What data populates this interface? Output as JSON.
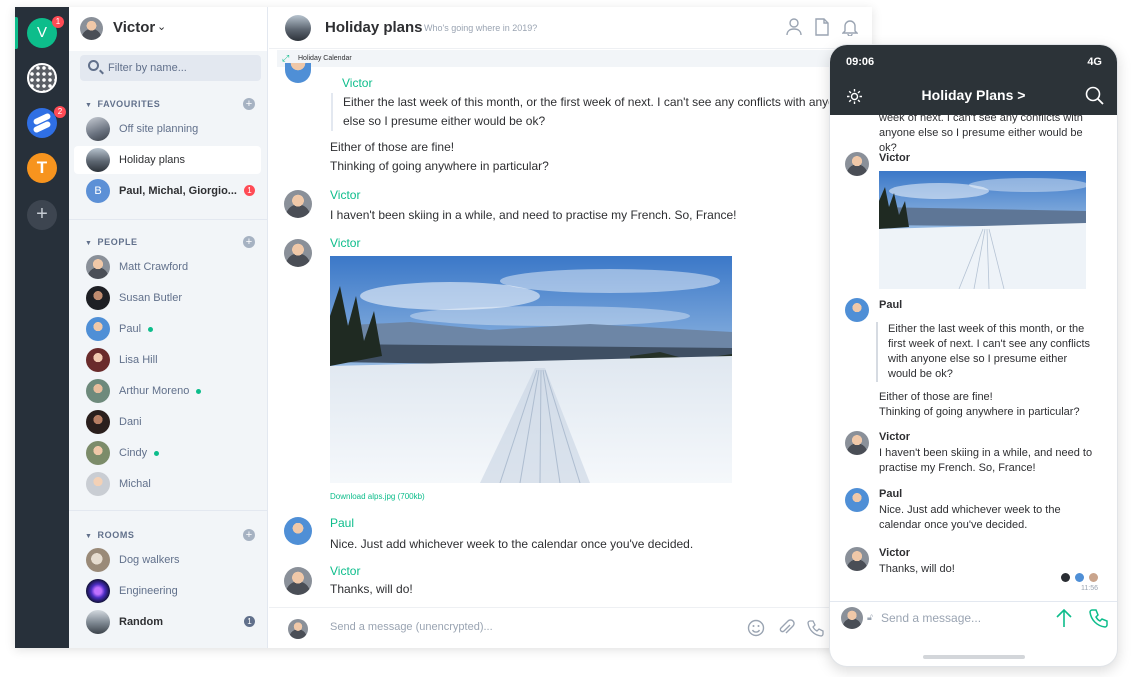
{
  "desktop": {
    "spaces": [
      {
        "name": "V",
        "badge": "1"
      },
      {
        "name": "dots-space"
      },
      {
        "name": "ring-space",
        "badge": "2"
      },
      {
        "name": "tf-space",
        "label": "T"
      }
    ],
    "add_space": "+",
    "user": {
      "name": "Victor"
    },
    "filter_placeholder": "Filter by name...",
    "sections": {
      "favourites": {
        "title": "FAVOURITES",
        "rooms": [
          {
            "name": "Off site planning"
          },
          {
            "name": "Holiday plans"
          },
          {
            "name": "Paul, Michal, Giorgio...",
            "badge": "1",
            "letter": "B"
          }
        ]
      },
      "people": {
        "title": "PEOPLE",
        "rooms": [
          {
            "name": "Matt Crawford"
          },
          {
            "name": "Susan Butler"
          },
          {
            "name": "Paul",
            "online": true
          },
          {
            "name": "Lisa Hill"
          },
          {
            "name": "Arthur Moreno",
            "online": true
          },
          {
            "name": "Dani"
          },
          {
            "name": "Cindy",
            "online": true
          },
          {
            "name": "Michal"
          }
        ]
      },
      "rooms": {
        "title": "ROOMS",
        "rooms": [
          {
            "name": "Dog walkers"
          },
          {
            "name": "Engineering"
          },
          {
            "name": "Random",
            "badge": "1"
          }
        ]
      }
    },
    "room": {
      "title": "Holiday plans",
      "topic": "Who's going where in 2019?",
      "widget": "Holiday Calendar"
    },
    "timeline": {
      "quote_sender": "Victor",
      "quote_lines": [
        "Either the last week of this month, or the first week of next. I can't see any conflicts with anyone",
        "else so I presume either would be ok?"
      ],
      "reply_lines": [
        "Either of those are fine!",
        "Thinking of going anywhere in particular?"
      ],
      "m1_sender": "Victor",
      "m1_body": "I haven't been skiing in a while, and need to practise my French. So, France!",
      "m2_sender": "Victor",
      "download": "Download alps.jpg (700kb)",
      "m3_sender": "Paul",
      "m3_body": "Nice. Just add whichever week to the calendar once you've decided.",
      "m4_sender": "Victor",
      "m4_body": "Thanks, will do!"
    },
    "composer_placeholder": "Send a message (unencrypted)..."
  },
  "phone": {
    "time": "09:06",
    "network": "4G",
    "title": "Holiday Plans",
    "title_chevron": ">",
    "top_lines": [
      "else so I presume either would be ok?"
    ],
    "top_text": "week of next. I can't see any conflicts with anyone else so I presume either would be ok?",
    "m1_name": "Victor",
    "m2_name": "Paul",
    "m2_quote": "Either the last week of this month, or the first week of next. I can't see any conflicts with anyone else so I presume either would be ok?",
    "m2_reply1": "Either of those are fine!",
    "m2_reply2": "Thinking of going anywhere in particular?",
    "m3_name": "Victor",
    "m3_body": "I haven't been skiing in a while, and need to practise my French. So, France!",
    "m4_name": "Paul",
    "m4_body": "Nice. Just add whichever week to the calendar once you've decided.",
    "m5_name": "Victor",
    "m5_body": "Thanks, will do!",
    "timestamp": "11:56",
    "composer_placeholder": "Send a message..."
  },
  "colors": {
    "accent": "#0dbd8b",
    "rail": "#27303a",
    "badge": "#ff4b55",
    "muted_badge": "#61708b"
  }
}
